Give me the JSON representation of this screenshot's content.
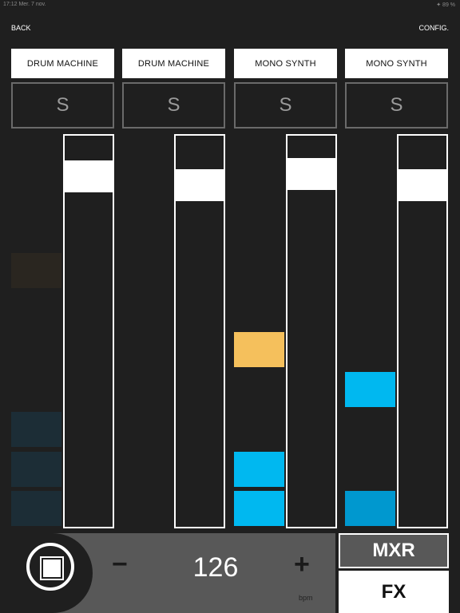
{
  "status_bar": {
    "left": "17:12 Mer. 7 nov.",
    "right": "✦ 89 %"
  },
  "header": {
    "back_label": "BACK",
    "config_label": "CONFIG."
  },
  "channels": [
    {
      "name": "DRUM MACHINE",
      "solo_label": "S",
      "fader_level": 0.94
    },
    {
      "name": "DRUM MACHINE",
      "solo_label": "S",
      "fader_level": 0.92
    },
    {
      "name": "MONO SYNTH",
      "solo_label": "S",
      "fader_level": 0.94
    },
    {
      "name": "MONO SYNTH",
      "solo_label": "S",
      "fader_level": 0.92
    }
  ],
  "pads": {
    "colors": {
      "orange": "#f5c05c",
      "cyan": "#00b8f0",
      "dim_blue": "#1c2d36",
      "dim_brown": "#2a2620"
    }
  },
  "transport": {
    "minus_label": "−",
    "plus_label": "+",
    "tempo": "126",
    "tempo_unit": "bpm"
  },
  "modes": {
    "mxr_label": "MXR",
    "fx_label": "FX"
  }
}
